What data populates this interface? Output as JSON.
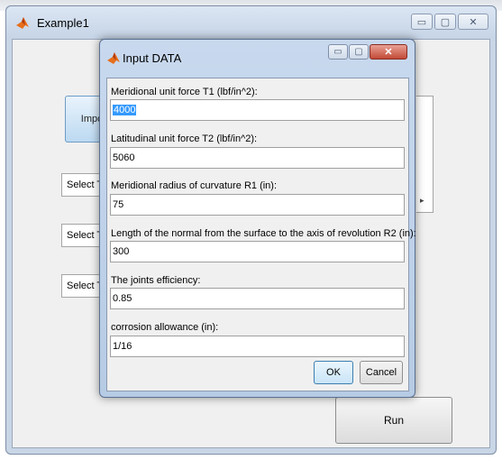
{
  "main_window": {
    "title": "Example1",
    "import_button_label": "Impo",
    "select_boxes": [
      "Select Th",
      "Select Th",
      "Select Th"
    ],
    "run_button_label": "Run",
    "right_panel_arrow": "▸"
  },
  "dialog": {
    "title": "Input DATA",
    "fields": [
      {
        "label": "Meridional unit force T1 (lbf/in^2):",
        "value": "4000",
        "selected": true
      },
      {
        "label": "Latitudinal unit force T2 (lbf/in^2):",
        "value": "5060",
        "selected": false
      },
      {
        "label": "Meridional radius of curvature R1 (in):",
        "value": "75",
        "selected": false
      },
      {
        "label": "Length of the normal from the surface to the axis of revolution R2 (in):",
        "value": "300",
        "selected": false
      },
      {
        "label": "The joints efficiency:",
        "value": "0.85",
        "selected": false
      },
      {
        "label": "corrosion allowance (in):",
        "value": "1/16",
        "selected": false
      }
    ],
    "ok_label": "OK",
    "cancel_label": "Cancel"
  },
  "icons": {
    "app_icon": "matlab-icon",
    "minimize": "minimize-icon",
    "maximize": "maximize-icon",
    "close": "close-icon"
  },
  "colors": {
    "title_bar": "#c6d4e6",
    "close_button": "#c24a36",
    "selection": "#3399ff"
  }
}
